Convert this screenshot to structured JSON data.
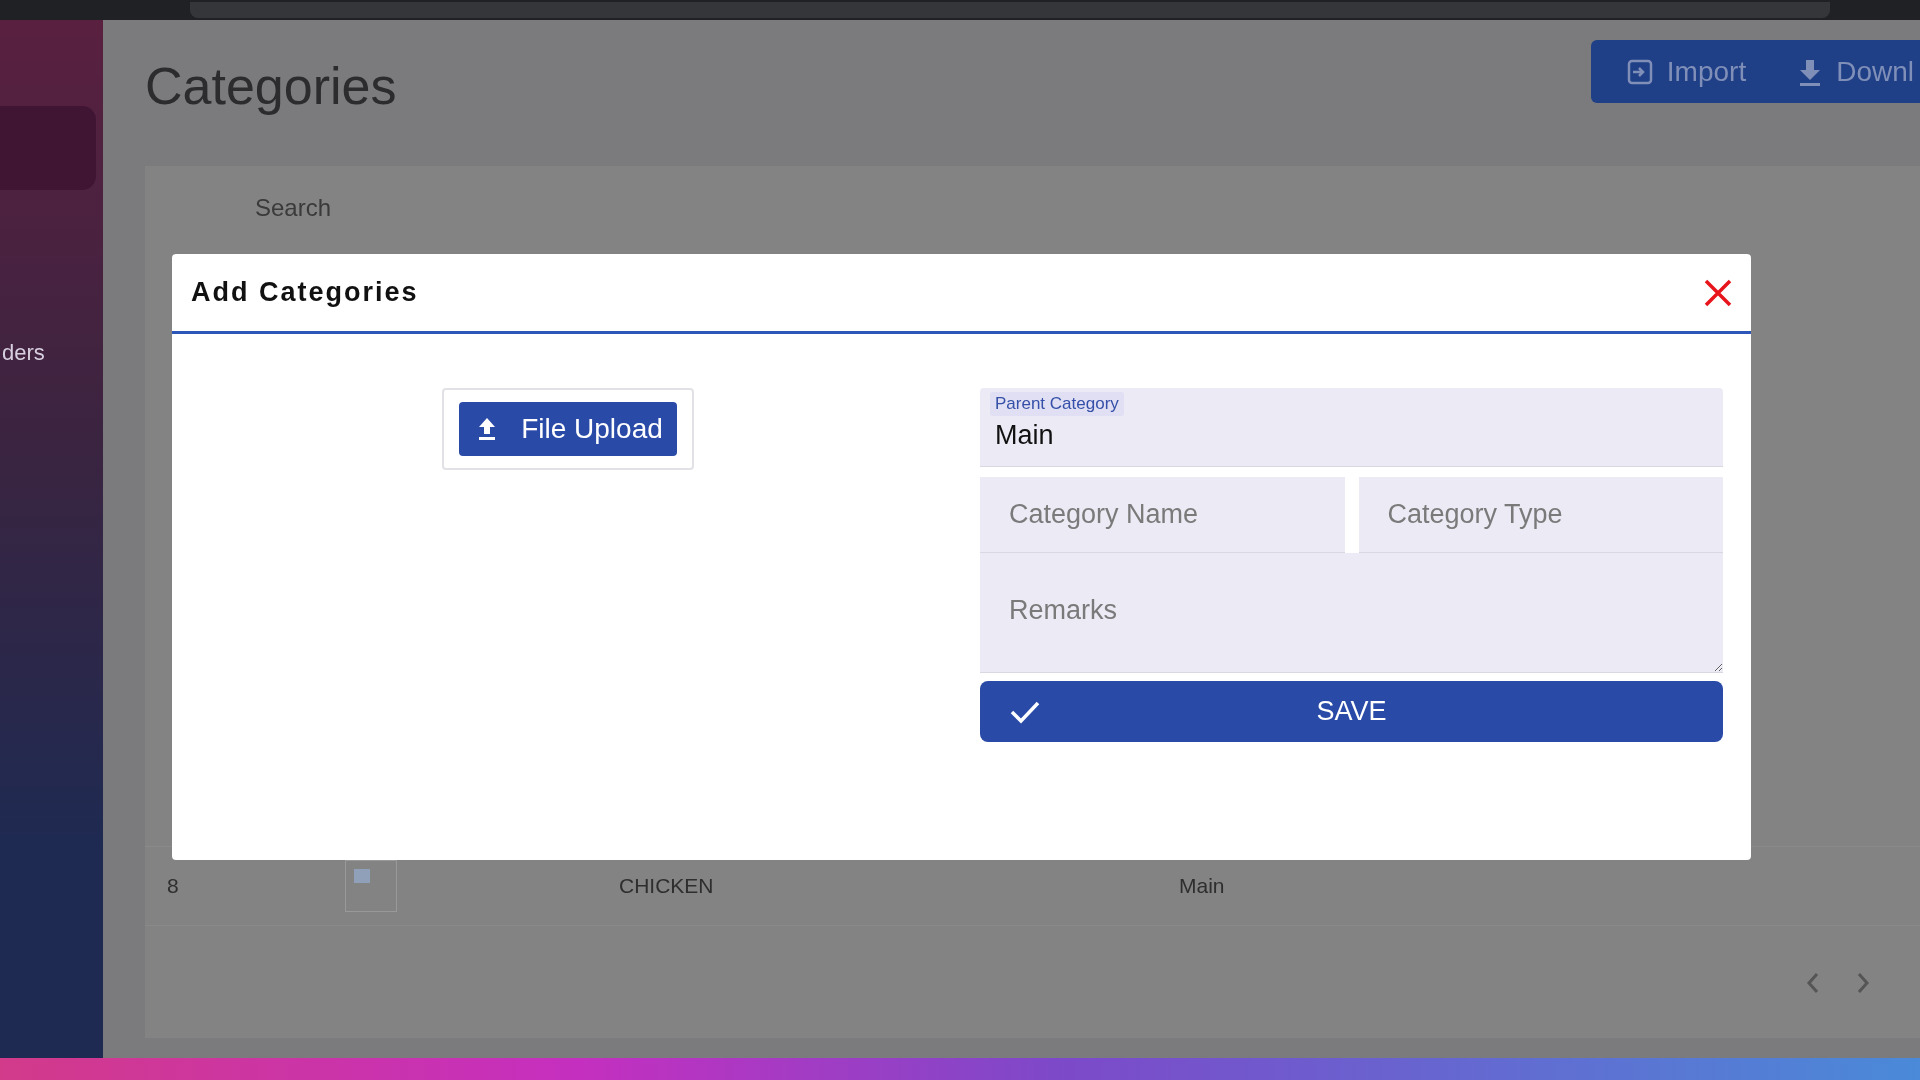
{
  "page": {
    "sidebar": {
      "item": "ders"
    },
    "title": "Categories",
    "actions": [
      {
        "kind": "import",
        "label": "Import"
      },
      {
        "kind": "download",
        "label": "Downl"
      }
    ],
    "search": {
      "placeholder": "Search"
    },
    "rows": [
      {
        "number": "8",
        "name": "CHICKEN",
        "parent": "Main"
      }
    ]
  },
  "dialog": {
    "title": "Add Categories",
    "upload_button": "File Upload",
    "fields": [
      {
        "kind": "select",
        "label": "Parent Category",
        "value": "Main"
      },
      {
        "kind": "input",
        "placeholder": "Category Name"
      },
      {
        "kind": "input",
        "placeholder": "Category Type"
      },
      {
        "kind": "textarea",
        "placeholder": "Remarks"
      }
    ],
    "save_button": "SAVE"
  }
}
